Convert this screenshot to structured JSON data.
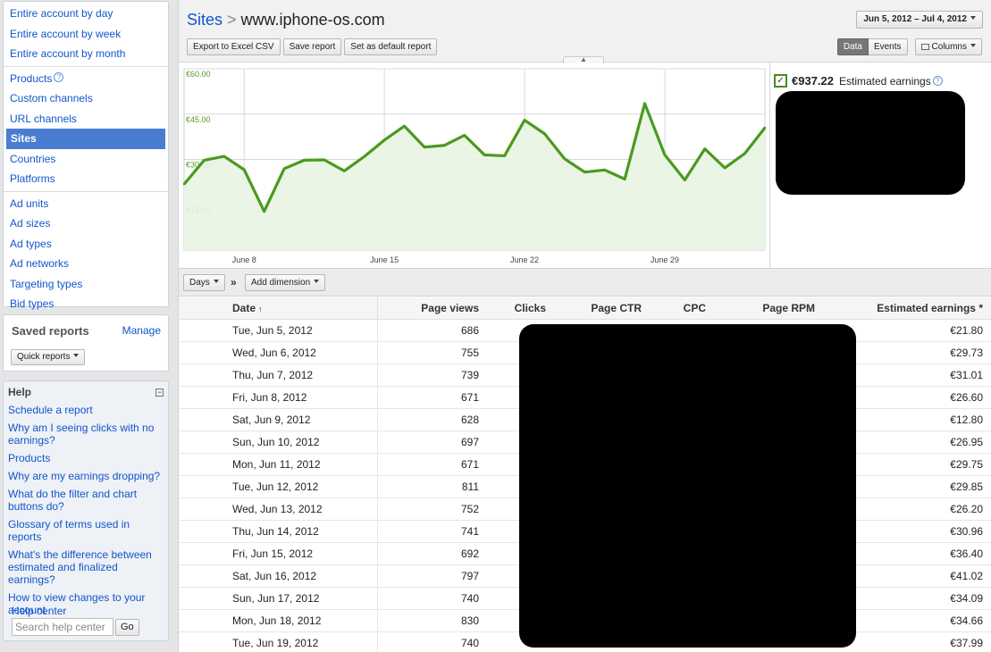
{
  "sidebar": {
    "groups": [
      [
        "Entire account by day",
        "Entire account by week",
        "Entire account by month"
      ],
      [
        "Products",
        "Custom channels",
        "URL channels",
        "Sites",
        "Countries",
        "Platforms"
      ],
      [
        "Ad units",
        "Ad sizes",
        "Ad types",
        "Ad networks",
        "Targeting types",
        "Bid types"
      ]
    ],
    "selected": "Sites",
    "saved_reports": {
      "title": "Saved reports",
      "manage": "Manage",
      "quick_reports": "Quick reports"
    },
    "help": {
      "title": "Help",
      "links": [
        "Schedule a report",
        "Why am I seeing clicks with no earnings?",
        "Products",
        "Why are my earnings dropping?",
        "What do the filter and chart buttons do?",
        "Glossary of terms used in reports",
        "What's the difference between estimated and finalized earnings?",
        "How to view changes to your account"
      ],
      "help_center": "Help center",
      "search_placeholder": "Search help center",
      "go": "Go"
    }
  },
  "header": {
    "crumb": "Sites",
    "separator": ">",
    "site": "www.iphone-os.com",
    "date_range": "Jun 5, 2012 – Jul 4, 2012",
    "toolbar": {
      "export": "Export to Excel CSV",
      "save": "Save report",
      "default": "Set as default report"
    },
    "view": {
      "data": "Data",
      "events": "Events",
      "columns": "Columns"
    }
  },
  "legend": {
    "value": "€937.22",
    "label": "Estimated earnings"
  },
  "chart_data": {
    "type": "area",
    "series": [
      {
        "name": "Estimated earnings",
        "color": "#4a9a1e",
        "values": [
          21.8,
          29.73,
          31.01,
          26.6,
          12.8,
          26.95,
          29.75,
          29.85,
          26.2,
          30.96,
          36.4,
          41.02,
          34.09,
          34.66,
          37.99,
          31.5,
          31.2,
          43.0,
          38.5,
          30.2,
          25.8,
          26.5,
          23.5,
          48.5,
          31.5,
          23.2,
          33.5,
          27.2,
          32.0,
          40.5
        ]
      }
    ],
    "x_ticks": [
      "June 8",
      "June 15",
      "June 22",
      "June 29"
    ],
    "x_tick_index": [
      3,
      10,
      17,
      24
    ],
    "y_ticks": [
      "€15.00",
      "€30.00",
      "€45.00",
      "€60.00"
    ],
    "ylim": [
      0,
      60
    ]
  },
  "dimensions": {
    "days": "Days",
    "arrow": "»",
    "add": "Add dimension"
  },
  "table": {
    "columns": [
      "Date",
      "Page views",
      "Clicks",
      "Page CTR",
      "CPC",
      "Page RPM",
      "Estimated earnings *"
    ],
    "sort_indicator": "↑",
    "rows": [
      [
        "Tue, Jun 5, 2012",
        "686",
        "€21.80"
      ],
      [
        "Wed, Jun 6, 2012",
        "755",
        "€29.73"
      ],
      [
        "Thu, Jun 7, 2012",
        "739",
        "€31.01"
      ],
      [
        "Fri, Jun 8, 2012",
        "671",
        "€26.60"
      ],
      [
        "Sat, Jun 9, 2012",
        "628",
        "€12.80"
      ],
      [
        "Sun, Jun 10, 2012",
        "697",
        "€26.95"
      ],
      [
        "Mon, Jun 11, 2012",
        "671",
        "€29.75"
      ],
      [
        "Tue, Jun 12, 2012",
        "811",
        "€29.85"
      ],
      [
        "Wed, Jun 13, 2012",
        "752",
        "€26.20"
      ],
      [
        "Thu, Jun 14, 2012",
        "741",
        "€30.96"
      ],
      [
        "Fri, Jun 15, 2012",
        "692",
        "€36.40"
      ],
      [
        "Sat, Jun 16, 2012",
        "797",
        "€41.02"
      ],
      [
        "Sun, Jun 17, 2012",
        "740",
        "€34.09"
      ],
      [
        "Mon, Jun 18, 2012",
        "830",
        "€34.66"
      ],
      [
        "Tue, Jun 19, 2012",
        "740",
        "€37.99"
      ]
    ]
  },
  "colors": {
    "link": "#1155cc",
    "selected_nav": "#4a7cd1",
    "series": "#4a9a1e",
    "fill": "#e9f4e2"
  }
}
